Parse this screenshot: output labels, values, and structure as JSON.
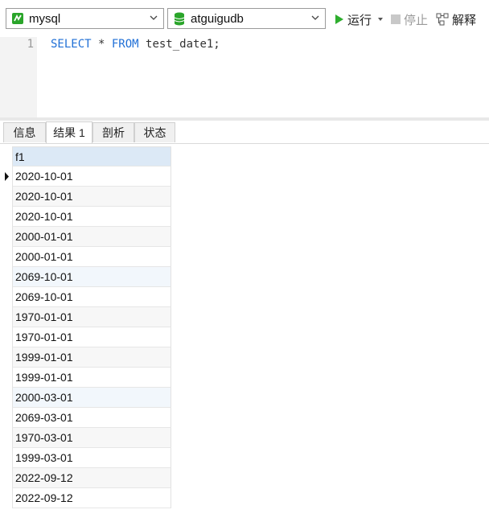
{
  "toolbar": {
    "connection": "mysql",
    "database": "atguigudb",
    "run_label": "运行",
    "stop_label": "停止",
    "explain_label": "解释",
    "colors": {
      "run": "#2eae2e",
      "conn_icon": "#2aa52a",
      "db_icon": "#2aa52a",
      "stop": "#c8c8c8"
    }
  },
  "editor": {
    "line_number": "1",
    "sql_keyword1": "SELECT",
    "sql_star": " * ",
    "sql_keyword2": "FROM",
    "sql_rest": " test_date1;"
  },
  "tabs": [
    "信息",
    "结果 1",
    "剖析",
    "状态"
  ],
  "grid": {
    "column": "f1",
    "rows": [
      "2020-10-01",
      "2020-10-01",
      "2020-10-01",
      "2000-01-01",
      "2000-01-01",
      "2069-10-01",
      "2069-10-01",
      "1970-01-01",
      "1970-01-01",
      "1999-01-01",
      "1999-01-01",
      "2000-03-01",
      "2069-03-01",
      "1970-03-01",
      "1999-03-01",
      "2022-09-12",
      "2022-09-12"
    ]
  }
}
